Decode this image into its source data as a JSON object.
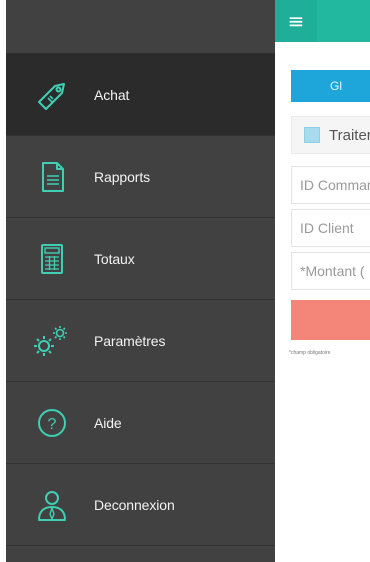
{
  "sidebar": {
    "items": [
      {
        "label": "Achat",
        "icon": "price-tag-icon",
        "active": true
      },
      {
        "label": "Rapports",
        "icon": "document-icon",
        "active": false
      },
      {
        "label": "Totaux",
        "icon": "calculator-icon",
        "active": false
      },
      {
        "label": "Paramètres",
        "icon": "gears-icon",
        "active": false
      },
      {
        "label": "Aide",
        "icon": "help-icon",
        "active": false
      },
      {
        "label": "Deconnexion",
        "icon": "user-logout-icon",
        "active": false
      }
    ]
  },
  "main": {
    "menu_icon": "≡",
    "blue_button_label": "Gl",
    "traiter_label": "Traiter",
    "fields": {
      "id_commande_placeholder": "ID Commande",
      "id_client_placeholder": "ID Client",
      "montant_placeholder": "*Montant ("
    },
    "required_note": "*champ obligatoire"
  },
  "colors": {
    "sidebar_bg": "#414141",
    "sidebar_active": "#2b2b2b",
    "accent": "#22b8a0",
    "icon": "#3fd0b4",
    "blue": "#1ea5d9",
    "salmon": "#f38579"
  }
}
